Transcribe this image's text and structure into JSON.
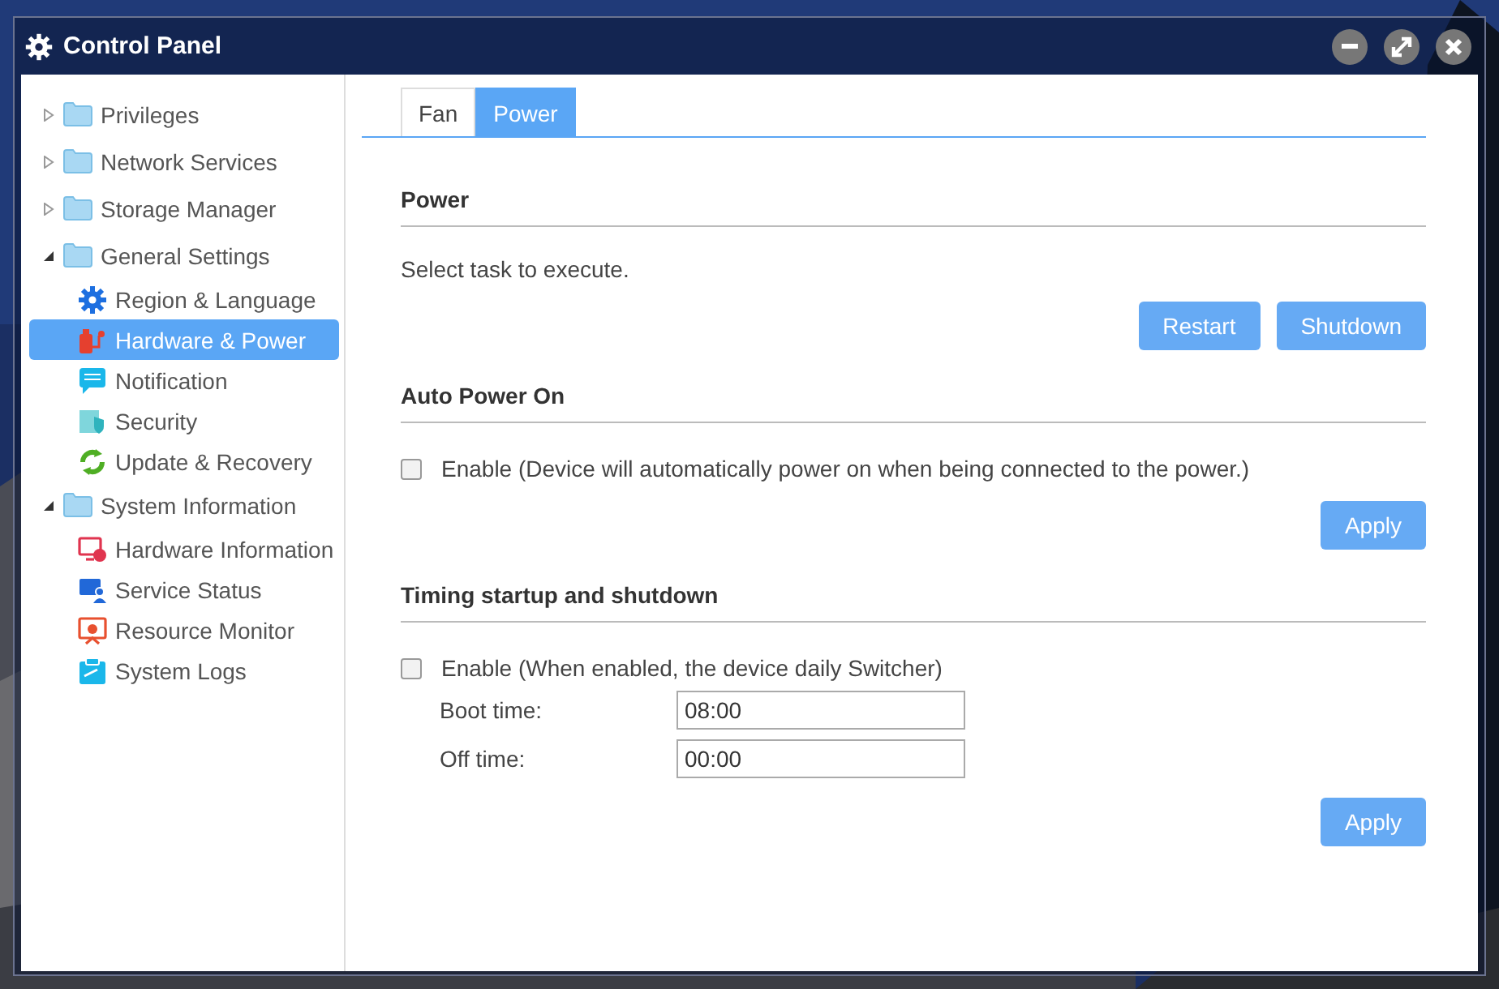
{
  "window": {
    "title": "Control Panel"
  },
  "sidebar": {
    "items": [
      {
        "label": "Privileges",
        "expanded": false,
        "selected": false
      },
      {
        "label": "Network Services",
        "expanded": false,
        "selected": false
      },
      {
        "label": "Storage Manager",
        "expanded": false,
        "selected": false
      },
      {
        "label": "General Settings",
        "expanded": true,
        "selected": false,
        "children": [
          {
            "label": "Region & Language",
            "kind": "gear",
            "selected": false
          },
          {
            "label": "Hardware & Power",
            "kind": "plug",
            "selected": true
          },
          {
            "label": "Notification",
            "kind": "chat",
            "selected": false
          },
          {
            "label": "Security",
            "kind": "shield",
            "selected": false
          },
          {
            "label": "Update & Recovery",
            "kind": "refresh",
            "selected": false
          }
        ]
      },
      {
        "label": "System Information",
        "expanded": true,
        "selected": false,
        "children": [
          {
            "label": "Hardware Information",
            "kind": "monitor-alert",
            "selected": false
          },
          {
            "label": "Service Status",
            "kind": "monitor-user",
            "selected": false
          },
          {
            "label": "Resource Monitor",
            "kind": "monitor-chart",
            "selected": false
          },
          {
            "label": "System Logs",
            "kind": "clipboard",
            "selected": false
          }
        ]
      }
    ]
  },
  "tabs": [
    {
      "label": "Fan",
      "selected": false
    },
    {
      "label": "Power",
      "selected": true
    }
  ],
  "sections": [
    {
      "title": "Power",
      "rows": [
        {
          "kind": "text",
          "text": "Select task to execute."
        }
      ],
      "buttons": [
        "Restart",
        "Shutdown"
      ]
    },
    {
      "title": "Auto Power On",
      "rows": [
        {
          "kind": "checkbox",
          "label": "Enable (Device will automatically power on when being connected to the power.)",
          "checked": false
        }
      ],
      "buttons": [
        "Apply"
      ]
    },
    {
      "title": "Timing startup and shutdown",
      "rows": [
        {
          "kind": "checkbox",
          "label": "Enable (When enabled, the device daily Switcher)",
          "checked": false
        },
        {
          "kind": "field",
          "label": "Boot time:",
          "value": "08:00"
        },
        {
          "kind": "field",
          "label": "Off time:",
          "value": "00:00"
        }
      ],
      "buttons": [
        "Apply"
      ]
    }
  ]
}
